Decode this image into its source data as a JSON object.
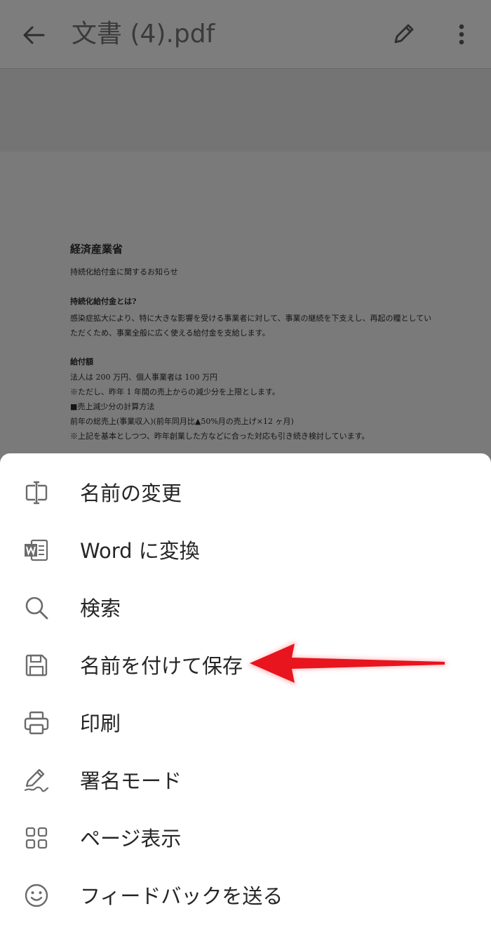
{
  "appbar": {
    "title": "文書 (4).pdf",
    "back_icon": "arrow-left-icon",
    "edit_icon": "pencil-icon",
    "more_icon": "more-vertical-icon"
  },
  "document": {
    "ministry": "経済産業省",
    "notice": "持続化給付金に関するお知らせ",
    "section1_heading": "持続化給付金とは?",
    "section1_text": "感染症拡大により、特に大きな影響を受ける事業者に対して、事業の継続を下支えし、再起の糧としていただくため、事業全般に広く使える給付金を支給します。",
    "section2_heading": "給付額",
    "lines": [
      "法人は 200 万円、個人事業者は 100 万円",
      "※ただし、昨年 1 年間の売上からの減少分を上限とします。",
      "■売上減少分の計算方法",
      "前年の総売上(事業収入)(前年同月比▲50%月の売上げ×12 ヶ月)",
      "※上記を基本としつつ、昨年創業した方などに合った対応も引き続き検討しています。"
    ]
  },
  "menu": {
    "items": [
      {
        "label": "名前の変更",
        "icon": "rename-icon"
      },
      {
        "label": "Word に変換",
        "icon": "word-icon"
      },
      {
        "label": "検索",
        "icon": "search-icon"
      },
      {
        "label": "名前を付けて保存",
        "icon": "save-icon"
      },
      {
        "label": "印刷",
        "icon": "print-icon"
      },
      {
        "label": "署名モード",
        "icon": "signature-icon"
      },
      {
        "label": "ページ表示",
        "icon": "grid-icon"
      },
      {
        "label": "フィードバックを送る",
        "icon": "smiley-icon"
      }
    ]
  },
  "colors": {
    "overlay": "#777777",
    "sheet_bg": "#ffffff",
    "icon": "#6b6b6b",
    "text": "#262626",
    "annotation_arrow": "#e8141e"
  }
}
